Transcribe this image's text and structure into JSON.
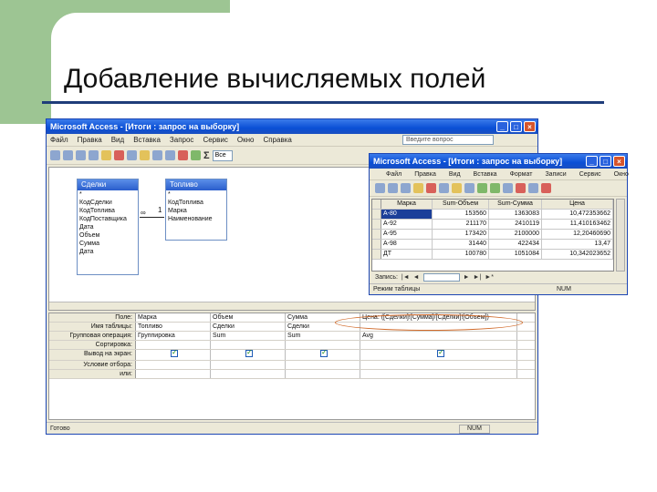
{
  "slide": {
    "title": "Добавление вычисляемых полей",
    "accent": "#9dc593",
    "rule_color": "#1f3d7a"
  },
  "main_window": {
    "title": "Microsoft Access - [Итоги : запрос на выборку]",
    "menu": [
      "Файл",
      "Правка",
      "Вид",
      "Вставка",
      "Запрос",
      "Сервис",
      "Окно",
      "Справка"
    ],
    "help_placeholder": "Введите вопрос",
    "toolbar_sigma": "Σ",
    "toolbar_value": "Все",
    "tables": [
      {
        "name": "Сделки",
        "fields": [
          "*",
          "КодСделки",
          "КодТоплива",
          "КодПоставщика",
          "Дата",
          "Объем",
          "Сумма",
          "Дата"
        ]
      },
      {
        "name": "Топливо",
        "fields": [
          "*",
          "КодТоплива",
          "Марка",
          "Наименование"
        ]
      }
    ],
    "join": {
      "left": "∞",
      "right": "1"
    },
    "grid": {
      "row_labels": [
        "Поле:",
        "Имя таблицы:",
        "Групповая операция:",
        "Сортировка:",
        "Вывод на экран:",
        "Условие отбора:",
        "или:"
      ],
      "columns": [
        {
          "field": "Марка",
          "table": "Топливо",
          "group": "Группировка"
        },
        {
          "field": "Объем",
          "table": "Сделки",
          "group": "Sum"
        },
        {
          "field": "Сумма",
          "table": "Сделки",
          "group": "Sum"
        },
        {
          "field": "Цена: ([Сделки]![Сумма]/[Сделки]![Объем])",
          "table": "",
          "group": "Avg"
        }
      ]
    },
    "status": "Готово",
    "status_num": "NUM"
  },
  "result_window": {
    "title": "Microsoft Access - [Итоги : запрос на выборку]",
    "menu": [
      "Файл",
      "Правка",
      "Вид",
      "Вставка",
      "Формат",
      "Записи",
      "Сервис",
      "Окно"
    ],
    "headers": [
      "Марка",
      "Sum-Объем",
      "Sum-Сумма",
      "Цена"
    ],
    "rows": [
      [
        "А-80",
        "153560",
        "1363083",
        "10,472353662"
      ],
      [
        "А-92",
        "211170",
        "2410119",
        "11,410163462"
      ],
      [
        "А-95",
        "173420",
        "2100000",
        "12,20460690"
      ],
      [
        "А-98",
        "31440",
        "422434",
        "13,47"
      ],
      [
        "ДТ",
        "100780",
        "1051084",
        "10,342023652"
      ]
    ],
    "nav_label": "Запись:",
    "status": "Режим таблицы",
    "status_num": "NUM"
  }
}
